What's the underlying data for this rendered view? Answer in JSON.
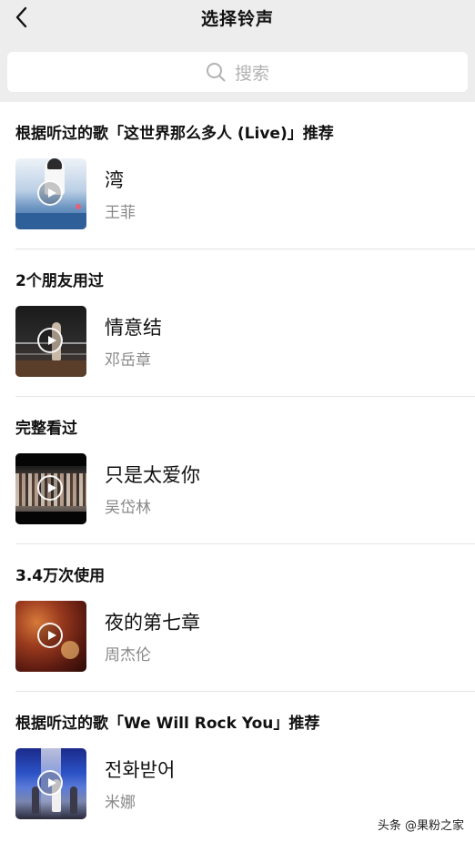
{
  "header": {
    "title": "选择铃声",
    "back_icon": "chevron-left-icon"
  },
  "search": {
    "placeholder": "搜索",
    "icon": "search-icon"
  },
  "sections": [
    {
      "heading": "根据听过的歌「这世界那么多人 (Live)」推荐",
      "song": {
        "title": "湾",
        "artist": "王菲"
      }
    },
    {
      "heading": "2个朋友用过",
      "song": {
        "title": "情意结",
        "artist": "邓岳章"
      }
    },
    {
      "heading": "完整看过",
      "song": {
        "title": "只是太爱你",
        "artist": "吴岱林"
      }
    },
    {
      "heading": "3.4万次使用",
      "song": {
        "title": "夜的第七章",
        "artist": "周杰伦"
      }
    },
    {
      "heading": "根据听过的歌「We Will Rock You」推荐",
      "song": {
        "title": "전화받어",
        "artist": "米娜"
      }
    }
  ],
  "watermark": "头条 @果粉之家",
  "colors": {
    "topbar_bg": "#ededed",
    "secondary_text": "#888888",
    "placeholder_text": "#b2b2b2"
  }
}
